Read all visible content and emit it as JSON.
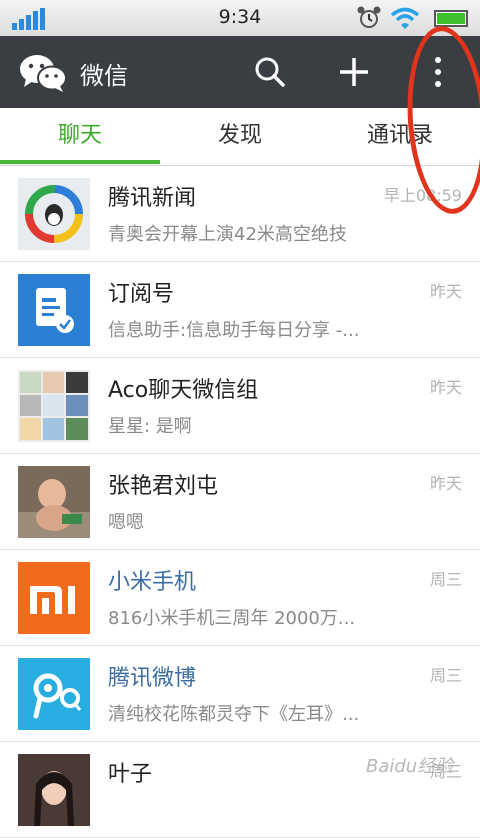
{
  "status": {
    "time": "9:34",
    "battery_level": 1.0,
    "accent": "#2a8ae0"
  },
  "header": {
    "app_name": "微信",
    "icons": [
      "wechat-logo-icon",
      "search-icon",
      "plus-icon",
      "more-vertical-icon"
    ],
    "background": "#3a3d41"
  },
  "tabs": [
    {
      "label": "聊天",
      "active": true
    },
    {
      "label": "发现",
      "active": false
    },
    {
      "label": "通讯录",
      "active": false
    }
  ],
  "colors": {
    "active_tab": "#3ca829",
    "link_name": "#3a6ea5",
    "annotation": "#e0341c"
  },
  "chats": [
    {
      "name": "腾讯新闻",
      "message": "青奥会开幕上演42米高空绝技",
      "time": "早上08:59",
      "avatar": "tencent-news-logo"
    },
    {
      "name": "订阅号",
      "message": "信息助手:信息助手每日分享  -...",
      "time": "昨天",
      "avatar": "subscription-icon"
    },
    {
      "name": "Aco聊天微信组",
      "message": "星星: 是啊",
      "time": "昨天",
      "avatar": "group-avatar-grid"
    },
    {
      "name": "张艳君刘屯",
      "message": "嗯嗯",
      "time": "昨天",
      "avatar": "baby-photo"
    },
    {
      "name": "小米手机",
      "message": "816小米手机三周年 2000万...",
      "time": "周三",
      "avatar": "xiaomi-logo"
    },
    {
      "name": "腾讯微博",
      "message": "清纯校花陈都灵夺下《左耳》...",
      "time": "周三",
      "avatar": "tencent-weibo-logo"
    },
    {
      "name": "叶子",
      "message": "",
      "time": "周三",
      "avatar": "portrait-photo"
    }
  ],
  "watermark": "Baidu经验"
}
